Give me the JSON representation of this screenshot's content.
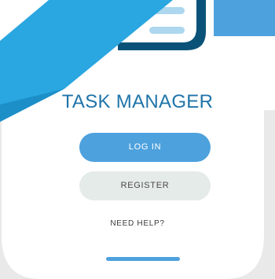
{
  "app": {
    "title": "TASK MANAGER"
  },
  "actions": {
    "login_label": "LOG IN",
    "register_label": "REGISTER",
    "help_label": "NEED HELP?"
  },
  "colors": {
    "primary": "#4da1dd",
    "title": "#1f74a9",
    "register_bg": "#e5ebe8",
    "frame_dark": "#0b5278",
    "ribbon": "#2aa6e0"
  },
  "icons": {
    "menu": "hamburger-menu-icon",
    "home_indicator": "home-indicator"
  }
}
